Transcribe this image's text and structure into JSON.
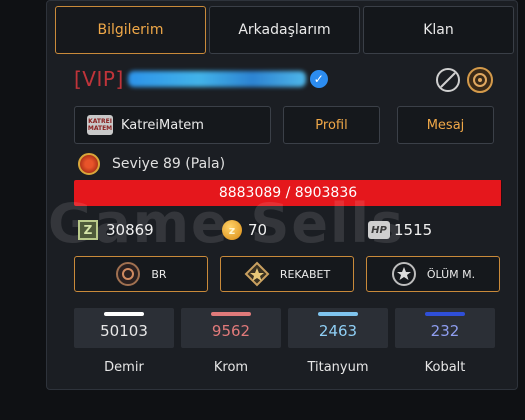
{
  "tabs": [
    {
      "label": "Bilgilerim",
      "active": true
    },
    {
      "label": "Arkadaşlarım",
      "active": false
    },
    {
      "label": "Klan",
      "active": false
    }
  ],
  "profile": {
    "vip_tag": "[VIP]",
    "verified_icon": "check-badge-icon",
    "icons": [
      "block-icon",
      "clan-emblem-icon"
    ]
  },
  "actions": {
    "clan_name": "KatreiMatem",
    "clan_logo_text": "KATREI MATEM",
    "profile_label": "Profil",
    "message_label": "Mesaj"
  },
  "level": {
    "text": "Seviye 89 (Pala)",
    "xp_text": "8883089 / 8903836",
    "xp_fraction": 0.9977
  },
  "watermark": "Game Sells",
  "stats": {
    "z_value": "30869",
    "coin_value": "70",
    "hp_label": "HP",
    "hp_value": "1515"
  },
  "ranks": [
    {
      "label": "BR",
      "icon": "br-rank-icon"
    },
    {
      "label": "REKABET",
      "icon": "competitive-rank-icon"
    },
    {
      "label": "ÖLÜM M.",
      "icon": "deathmatch-rank-icon"
    }
  ],
  "ores": [
    {
      "value": "50103",
      "label": "Demir",
      "strip_color": "#ffffff",
      "value_color": "#e8e8e8"
    },
    {
      "value": "9562",
      "label": "Krom",
      "strip_color": "#e07a7a",
      "value_color": "#e07a7a"
    },
    {
      "value": "2463",
      "label": "Titanyum",
      "strip_color": "#7fc4ee",
      "value_color": "#8fcff5"
    },
    {
      "value": "232",
      "label": "Kobalt",
      "strip_color": "#2f4fd8",
      "value_color": "#8f9ef0"
    }
  ],
  "colors": {
    "accent_orange": "#f0a848",
    "xp_red": "#e5171c",
    "vip_red": "#c0343a"
  }
}
